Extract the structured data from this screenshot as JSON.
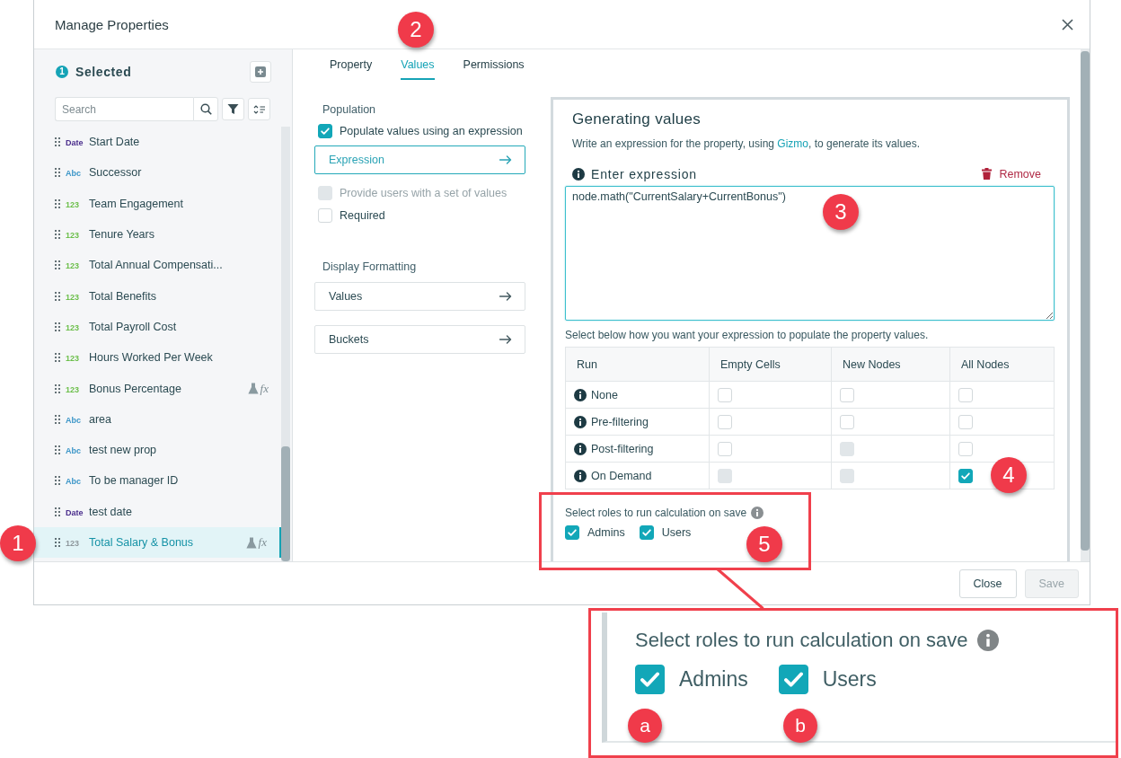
{
  "window": {
    "title": "Manage Properties"
  },
  "sidebar": {
    "selected_count": "1",
    "heading": "Selected",
    "search": {
      "placeholder": "Search"
    },
    "items": [
      {
        "type": "Date",
        "color": "#4a2d8c",
        "label": "Start Date",
        "selected": false
      },
      {
        "type": "Abc",
        "color": "#3c96c8",
        "label": "Successor",
        "selected": false
      },
      {
        "type": "123",
        "color": "#6cbf4b",
        "label": "Team Engagement",
        "selected": false
      },
      {
        "type": "123",
        "color": "#6cbf4b",
        "label": "Tenure Years",
        "selected": false
      },
      {
        "type": "123",
        "color": "#6cbf4b",
        "label": "Total Annual Compensati...",
        "selected": false
      },
      {
        "type": "123",
        "color": "#6cbf4b",
        "label": "Total Benefits",
        "selected": false
      },
      {
        "type": "123",
        "color": "#6cbf4b",
        "label": "Total Payroll Cost",
        "selected": false
      },
      {
        "type": "123",
        "color": "#6cbf4b",
        "label": "Hours Worked Per Week",
        "selected": false
      },
      {
        "type": "123",
        "color": "#6cbf4b",
        "label": "Bonus Percentage",
        "selected": false,
        "formula": "fx"
      },
      {
        "type": "Abc",
        "color": "#3c96c8",
        "label": "area",
        "selected": false
      },
      {
        "type": "Abc",
        "color": "#3c96c8",
        "label": "test new prop",
        "selected": false
      },
      {
        "type": "Abc",
        "color": "#3c96c8",
        "label": "To be manager ID",
        "selected": false
      },
      {
        "type": "Date",
        "color": "#4a2d8c",
        "label": "test date",
        "selected": false
      },
      {
        "type": "123",
        "color": "#8e979c",
        "label": "Total Salary & Bonus",
        "selected": true,
        "formula": "fx"
      }
    ]
  },
  "tabs": [
    {
      "label": "Property",
      "selected": false
    },
    {
      "label": "Values",
      "selected": true
    },
    {
      "label": "Permissions",
      "selected": false
    }
  ],
  "population": {
    "heading": "Population",
    "controls": [
      {
        "kind": "checkbox",
        "label": "Populate values using an expression",
        "checked": true,
        "disabled": false
      },
      {
        "kind": "link-button",
        "label": "Expression",
        "selected": true
      },
      {
        "kind": "checkbox",
        "label": "Provide users with a set of values",
        "checked": false,
        "disabled": true
      },
      {
        "kind": "checkbox",
        "label": "Required",
        "checked": false,
        "disabled": false
      }
    ]
  },
  "display_formatting": {
    "heading": "Display Formatting",
    "buttons": [
      {
        "label": "Values",
        "selected": false
      },
      {
        "label": "Buckets",
        "selected": false
      }
    ]
  },
  "generating": {
    "title": "Generating values",
    "description": {
      "before": "Write an expression for the property, using ",
      "link": "Gizmo",
      "after": ", to generate its values."
    },
    "expression_label": "Enter expression",
    "remove": "Remove",
    "expression": "node.math(\"CurrentSalary+CurrentBonus\")",
    "hint": "Select below how you want your expression to populate the property values.",
    "table": {
      "columns": [
        "Run",
        "Empty Cells",
        "New Nodes",
        "All Nodes"
      ],
      "rows": [
        {
          "label": "None",
          "cells": [
            {
              "checked": false,
              "disabled": false
            },
            {
              "checked": false,
              "disabled": false
            },
            {
              "checked": false,
              "disabled": false
            }
          ]
        },
        {
          "label": "Pre-filtering",
          "cells": [
            {
              "checked": false,
              "disabled": false
            },
            {
              "checked": false,
              "disabled": false
            },
            {
              "checked": false,
              "disabled": false
            }
          ]
        },
        {
          "label": "Post-filtering",
          "cells": [
            {
              "checked": false,
              "disabled": false
            },
            {
              "checked": false,
              "disabled": true
            },
            {
              "checked": false,
              "disabled": false
            }
          ]
        },
        {
          "label": "On Demand",
          "cells": [
            {
              "checked": false,
              "disabled": true
            },
            {
              "checked": false,
              "disabled": true
            },
            {
              "checked": true,
              "disabled": false
            }
          ]
        }
      ]
    },
    "roles": {
      "label": "Select roles to run calculation on save",
      "items": [
        {
          "label": "Admins",
          "checked": true
        },
        {
          "label": "Users",
          "checked": true
        }
      ]
    }
  },
  "footer": {
    "buttons": [
      {
        "label": "Close",
        "disabled": false
      },
      {
        "label": "Save",
        "disabled": true
      }
    ]
  },
  "callouts": [
    {
      "label": "1"
    },
    {
      "label": "2"
    },
    {
      "label": "3"
    },
    {
      "label": "4"
    },
    {
      "label": "5"
    }
  ],
  "zoom_inset": {
    "label": "Select roles to run calculation on save",
    "roles": [
      {
        "label": "Admins",
        "checked": true
      },
      {
        "label": "Users",
        "checked": true
      }
    ],
    "callouts": [
      {
        "label": "a"
      },
      {
        "label": "b"
      }
    ]
  }
}
